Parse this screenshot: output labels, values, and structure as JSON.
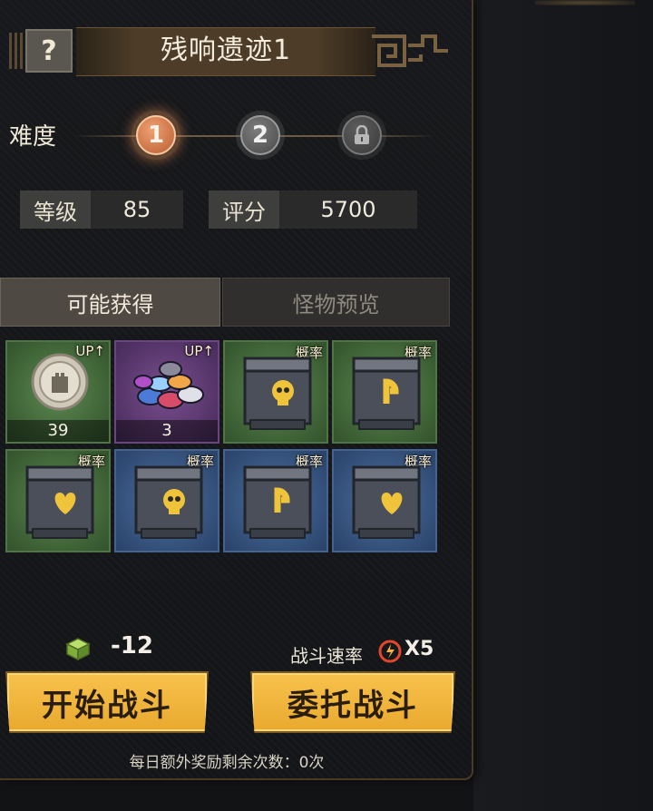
{
  "header": {
    "help_label": "?",
    "title": "残响遗迹1"
  },
  "difficulty": {
    "label": "难度",
    "levels": [
      {
        "label": "1",
        "state": "selected"
      },
      {
        "label": "2",
        "state": "available"
      },
      {
        "label": "",
        "state": "locked",
        "icon": "lock-icon"
      }
    ]
  },
  "stats": {
    "level_label": "等级",
    "level_value": "85",
    "score_label": "评分",
    "score_value": "5700"
  },
  "tabs": [
    {
      "label": "可能获得",
      "active": true
    },
    {
      "label": "怪物预览",
      "active": false
    }
  ],
  "rewards": [
    {
      "name": "silver-coin",
      "tag": "UP",
      "count": "39",
      "rarity_color": "#5e8a52",
      "icon": "coin-icon"
    },
    {
      "name": "chip-pile",
      "tag": "UP",
      "count": "3",
      "rarity_color": "#7a4f8e",
      "icon": "chips-icon"
    },
    {
      "name": "skull-crate",
      "tag": "概率",
      "count": "",
      "rarity_color": "#5e8a52",
      "icon": "skull-crate-icon"
    },
    {
      "name": "horseshoe-crate",
      "tag": "概率",
      "count": "",
      "rarity_color": "#5e8a52",
      "icon": "horseshoe-crate-icon"
    },
    {
      "name": "heart-crate",
      "tag": "概率",
      "count": "",
      "rarity_color": "#5e8a52",
      "icon": "heart-crate-icon"
    },
    {
      "name": "skull-crate",
      "tag": "概率",
      "count": "",
      "rarity_color": "#4e6e9c",
      "icon": "skull-crate-icon"
    },
    {
      "name": "horseshoe-crate",
      "tag": "概率",
      "count": "",
      "rarity_color": "#4e6e9c",
      "icon": "horseshoe-crate-icon"
    },
    {
      "name": "heart-crate",
      "tag": "概率",
      "count": "",
      "rarity_color": "#4e6e9c",
      "icon": "heart-crate-icon"
    }
  ],
  "cost": {
    "icon": "energy-cube-icon",
    "value": "-12"
  },
  "speed": {
    "label": "战斗速率",
    "icon": "speed-dial-icon",
    "multiplier": "X5"
  },
  "actions": {
    "start_label": "开始战斗",
    "delegate_label": "委托战斗"
  },
  "footer": {
    "note": "每日额外奖励剩余次数：0次"
  }
}
